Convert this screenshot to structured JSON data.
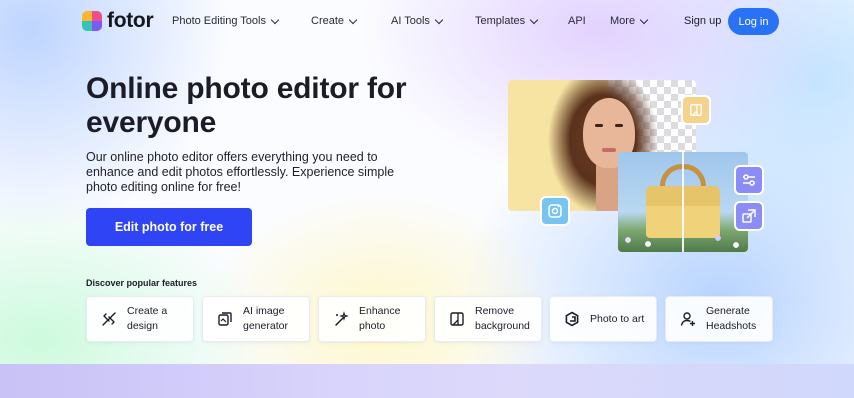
{
  "brand": {
    "name": "fotor"
  },
  "nav": {
    "items": [
      {
        "label": "Photo Editing Tools",
        "has_dropdown": true
      },
      {
        "label": "Create",
        "has_dropdown": true
      },
      {
        "label": "AI Tools",
        "has_dropdown": true
      },
      {
        "label": "Templates",
        "has_dropdown": true
      },
      {
        "label": "API",
        "has_dropdown": false
      },
      {
        "label": "More",
        "has_dropdown": true
      }
    ],
    "signup_label": "Sign up",
    "login_label": "Log in"
  },
  "hero": {
    "title": "Online photo editor for everyone",
    "description": "Our online photo editor offers everything you need to enhance and edit photos effortlessly. Experience simple photo editing online for free!",
    "cta_label": "Edit photo for free"
  },
  "features": {
    "heading": "Discover popular features",
    "items": [
      {
        "label": "Create a design",
        "icon": "design-tools-icon"
      },
      {
        "label": "AI image generator",
        "icon": "ai-image-icon"
      },
      {
        "label": "Enhance photo",
        "icon": "magic-wand-icon"
      },
      {
        "label": "Remove background",
        "icon": "remove-background-icon"
      },
      {
        "label": "Photo to art",
        "icon": "art-brush-icon"
      },
      {
        "label": "Generate Headshots",
        "icon": "headshot-icon"
      }
    ]
  },
  "colors": {
    "accent": "#2f44f5",
    "login": "#2a72f5",
    "badge_purple": "#8b8cf5",
    "badge_yellow": "#f5d38a",
    "badge_blue": "#78c4f0"
  }
}
